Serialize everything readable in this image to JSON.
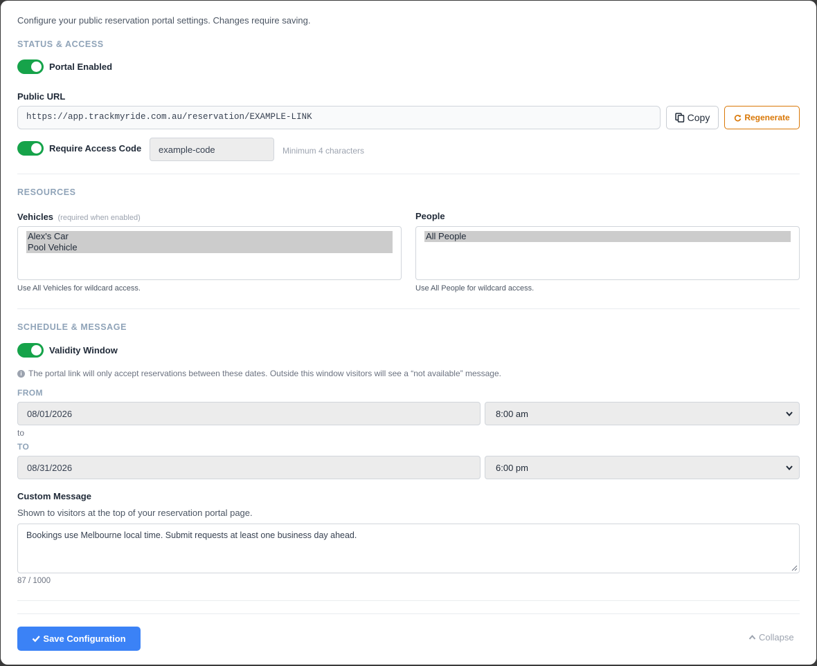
{
  "intro": "Configure your public reservation portal settings. Changes require saving.",
  "status_access": {
    "title": "STATUS & ACCESS",
    "portal_enabled": {
      "label": "Portal Enabled",
      "on": true
    },
    "public_url_label": "Public URL",
    "public_url": "https://app.trackmyride.com.au/reservation/EXAMPLE-LINK",
    "copy_label": "Copy",
    "regenerate_label": "Regenerate",
    "require_code": {
      "label": "Require Access Code",
      "on": true,
      "value": "example-code",
      "hint": "Minimum 4 characters"
    }
  },
  "resources": {
    "title": "RESOURCES",
    "vehicles": {
      "label": "Vehicles",
      "note": "(required when enabled)",
      "options": [
        "Alex's Car",
        "Pool Vehicle"
      ],
      "hint": "Use All Vehicles for wildcard access."
    },
    "people": {
      "label": "People",
      "options": [
        "All People"
      ],
      "hint": "Use All People for wildcard access."
    }
  },
  "schedule": {
    "title": "SCHEDULE & MESSAGE",
    "validity": {
      "label": "Validity Window",
      "on": true
    },
    "info": "The portal link will only accept reservations between these dates. Outside this window visitors will see a “not available” message.",
    "from_label": "FROM",
    "from_date": "08/01/2026",
    "from_time": "8:00 am",
    "to_word": "to",
    "to_label": "TO",
    "to_date": "08/31/2026",
    "to_time": "6:00 pm",
    "message_label": "Custom Message",
    "message_hint": "Shown to visitors at the top of your reservation portal page.",
    "message_value": "Bookings use Melbourne local time. Submit requests at least one business day ahead.",
    "char_count": "87 / 1000"
  },
  "footer": {
    "save_label": "Save Configuration",
    "collapse_label": "Collapse"
  },
  "colors": {
    "toggle_on": "#16a34a",
    "primary": "#3b82f6",
    "warning": "#d97706",
    "section_title": "#8fa3b8"
  }
}
